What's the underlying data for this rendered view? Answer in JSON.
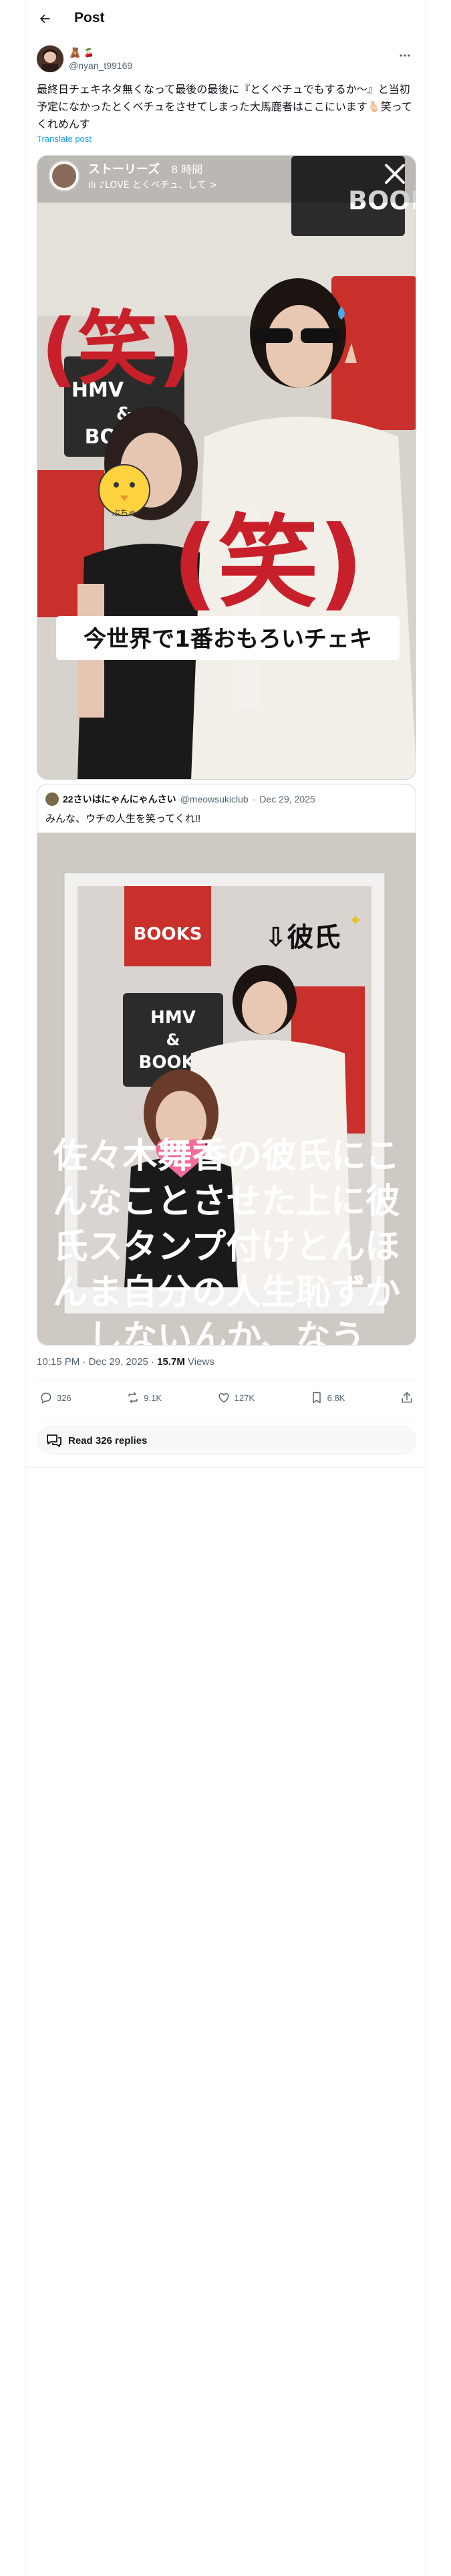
{
  "header": {
    "title": "Post"
  },
  "author": {
    "emoji": "🧸",
    "badge": "🍒",
    "handle": "@nyan_t99169"
  },
  "tweet": {
    "text": "最終日チェキネタ無くなって最後の最後に『とくベチュでもするか〜』と当初予定になかったとくベチュをさせてしまった大馬鹿者はここにいます🫰🏻笑ってくれめんす",
    "translate_label": "Translate post"
  },
  "media1": {
    "story_label": "ストーリーズ",
    "story_time": "8 時間",
    "music_label": "ılı ♪LOVE とくベチュ、して >",
    "laugh_1": "(笑)",
    "laugh_2": "(笑)",
    "sign_top": "BOOKS",
    "sign_hmv": "HMV",
    "sign_amp": "&",
    "sign_books": "BOOKS",
    "sticker_text": "ぶちゅ",
    "caption": "今世界で1番おもろいチェキ"
  },
  "quote": {
    "name": "22さいはにゃんにゃんさい",
    "handle": "@meowsukiclub",
    "date": "Dec 29, 2025",
    "text": "みんな、ウチの人生を笑ってくれ!!",
    "arrow_label": "⇩彼氏",
    "overlay_text": "佐々木舞香の彼氏にこんなことさせた上に彼氏スタンプ付けとんほんま自分の人生恥ずかしないんか、なう"
  },
  "meta": {
    "time": "10:15 PM",
    "date": "Dec 29, 2025",
    "views_count": "15.7M",
    "views_label": "Views"
  },
  "actions": {
    "replies": "326",
    "reposts": "9.1K",
    "likes": "127K",
    "bookmarks": "6.8K"
  },
  "read_replies": "Read 326 replies",
  "colors": {
    "text_primary": "#0f1419",
    "text_secondary": "#536471",
    "link": "#1d9bf0",
    "laugh_red": "#c8202a",
    "hmv_red": "#c92f2b"
  },
  "icons": [
    "back-arrow-icon",
    "more-icon",
    "close-icon",
    "reply-icon",
    "repost-icon",
    "like-icon",
    "bookmark-icon",
    "share-icon",
    "chat-bubbles-icon"
  ]
}
